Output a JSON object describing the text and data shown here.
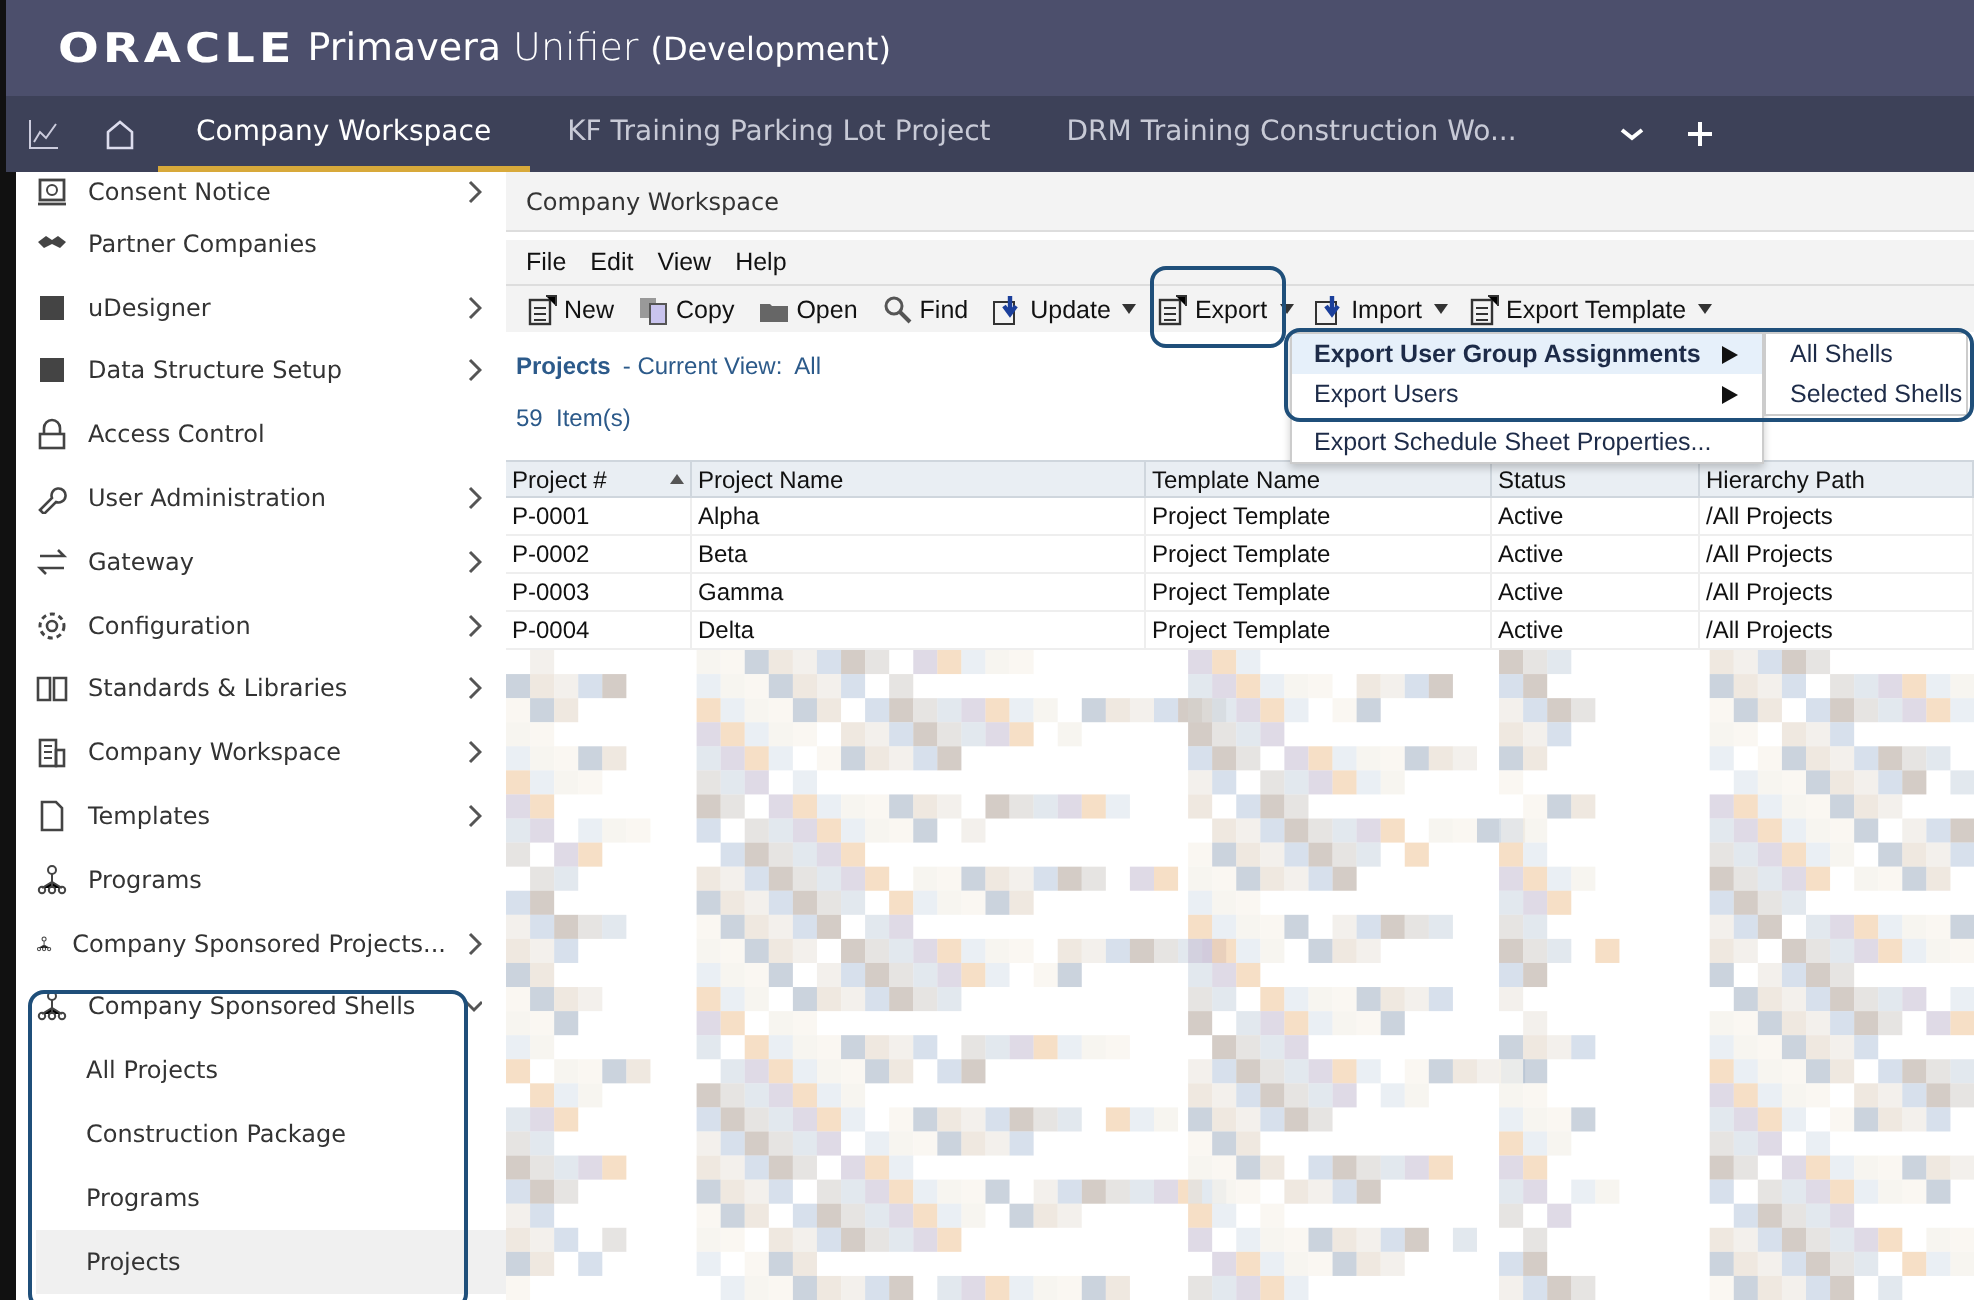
{
  "app_title": {
    "brand": "ORACLE",
    "product": "Primavera",
    "name": "Unifier",
    "env": "(Development)"
  },
  "tabs": [
    {
      "label": "Company Workspace",
      "selected": true
    },
    {
      "label": "KF Training Parking Lot Project",
      "selected": false
    },
    {
      "label": "DRM Training Construction Wo...",
      "selected": false
    }
  ],
  "sidebar": {
    "items": [
      {
        "label": "Consent Notice",
        "has_submenu": true
      },
      {
        "label": "Partner Companies",
        "has_submenu": false
      },
      {
        "label": "uDesigner",
        "has_submenu": true
      },
      {
        "label": "Data Structure Setup",
        "has_submenu": true
      },
      {
        "label": "Access Control",
        "has_submenu": false
      },
      {
        "label": "User Administration",
        "has_submenu": true
      },
      {
        "label": "Gateway",
        "has_submenu": true
      },
      {
        "label": "Configuration",
        "has_submenu": true
      },
      {
        "label": "Standards & Libraries",
        "has_submenu": true
      },
      {
        "label": "Company Workspace",
        "has_submenu": true
      },
      {
        "label": "Templates",
        "has_submenu": true
      },
      {
        "label": "Programs",
        "has_submenu": false
      },
      {
        "label": "Company Sponsored Projects...",
        "has_submenu": true
      },
      {
        "label": "Company Sponsored Shells",
        "has_submenu": true,
        "expanded": true,
        "children": [
          {
            "label": "All Projects",
            "selected": false
          },
          {
            "label": "Construction Package",
            "selected": false
          },
          {
            "label": "Programs",
            "selected": false
          },
          {
            "label": "Projects",
            "selected": true
          }
        ]
      }
    ]
  },
  "breadcrumb": "Company Workspace",
  "menu_bar": [
    "File",
    "Edit",
    "View",
    "Help"
  ],
  "toolbar": [
    {
      "label": "New",
      "dropdown": false
    },
    {
      "label": "Copy",
      "dropdown": false
    },
    {
      "label": "Open",
      "dropdown": false
    },
    {
      "label": "Find",
      "dropdown": false
    },
    {
      "label": "Update",
      "dropdown": true
    },
    {
      "label": "Export",
      "dropdown": true
    },
    {
      "label": "Import",
      "dropdown": true
    },
    {
      "label": "Export Template",
      "dropdown": true
    }
  ],
  "view": {
    "title": "Projects",
    "current_view_label": "- Current View:",
    "current_view": "All",
    "count": "59  Item(s)"
  },
  "table": {
    "columns": [
      {
        "label": "Project #",
        "sorted": true
      },
      {
        "label": "Project Name",
        "sorted": false
      },
      {
        "label": "Template Name",
        "sorted": false
      },
      {
        "label": "Status",
        "sorted": false
      },
      {
        "label": "Hierarchy Path",
        "sorted": false
      }
    ],
    "rows": [
      [
        "P-0001",
        "Alpha",
        "Project Template",
        "Active",
        "/All Projects"
      ],
      [
        "P-0002",
        "Beta",
        "Project Template",
        "Active",
        "/All Projects"
      ],
      [
        "P-0003",
        "Gamma",
        "Project Template",
        "Active",
        "/All Projects"
      ],
      [
        "P-0004",
        "Delta",
        "Project Template",
        "Active",
        "/All Projects"
      ]
    ]
  },
  "export_menu": {
    "items": [
      {
        "label": "Export User Group Assignments",
        "has_submenu": true,
        "selected": true
      },
      {
        "label": "Export Users",
        "has_submenu": true,
        "selected": false
      },
      {
        "label": "Export Schedule Sheet Properties...",
        "has_submenu": false,
        "selected": false
      }
    ],
    "submenu": [
      "All Shells",
      "Selected Shells"
    ]
  }
}
